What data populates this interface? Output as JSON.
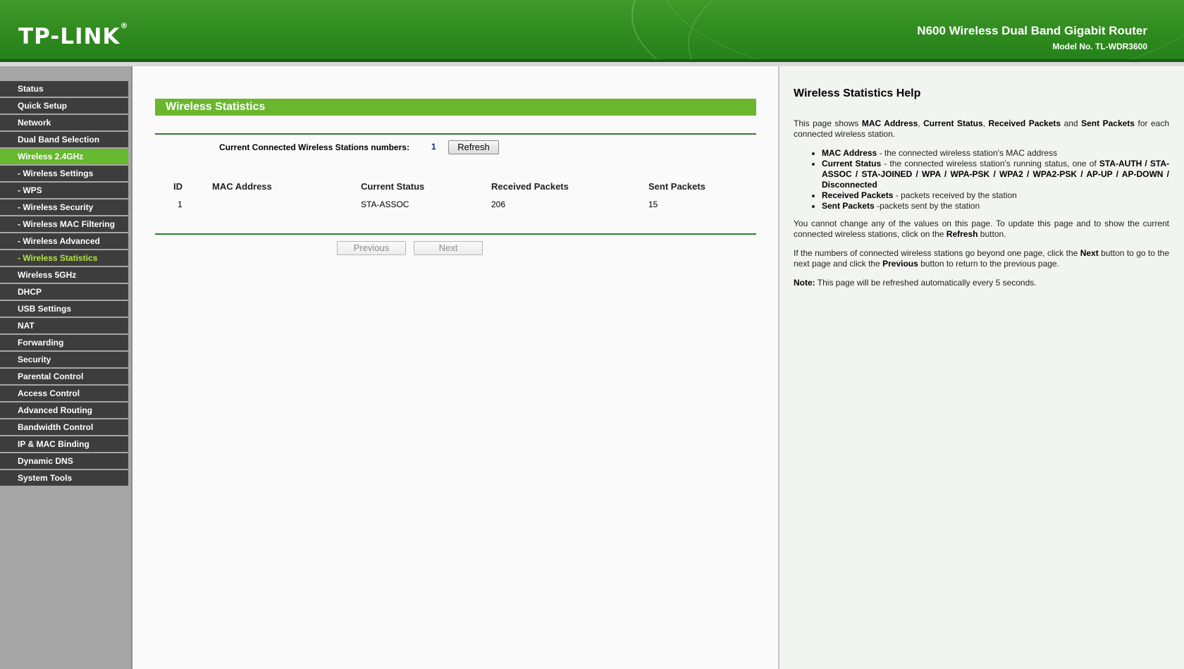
{
  "header": {
    "logo": "TP-LINK",
    "logo_mark": "®",
    "product": "N600 Wireless Dual Band Gigabit Router",
    "model": "Model No. TL-WDR3600"
  },
  "sidebar": {
    "items": [
      {
        "label": "Status"
      },
      {
        "label": "Quick Setup"
      },
      {
        "label": "Network"
      },
      {
        "label": "Dual Band Selection"
      },
      {
        "label": "Wireless 2.4GHz"
      },
      {
        "label": "- Wireless Settings"
      },
      {
        "label": "- WPS"
      },
      {
        "label": "- Wireless Security"
      },
      {
        "label": "- Wireless MAC Filtering"
      },
      {
        "label": "- Wireless Advanced"
      },
      {
        "label": "- Wireless Statistics"
      },
      {
        "label": "Wireless 5GHz"
      },
      {
        "label": "DHCP"
      },
      {
        "label": "USB Settings"
      },
      {
        "label": "NAT"
      },
      {
        "label": "Forwarding"
      },
      {
        "label": "Security"
      },
      {
        "label": "Parental Control"
      },
      {
        "label": "Access Control"
      },
      {
        "label": "Advanced Routing"
      },
      {
        "label": "Bandwidth Control"
      },
      {
        "label": "IP & MAC Binding"
      },
      {
        "label": "Dynamic DNS"
      },
      {
        "label": "System Tools"
      }
    ]
  },
  "main": {
    "title": "Wireless Statistics",
    "count_label": "Current Connected Wireless Stations numbers:",
    "count_value": "1",
    "refresh_label": "Refresh",
    "table": {
      "headers": [
        "ID",
        "MAC Address",
        "Current Status",
        "Received Packets",
        "Sent Packets"
      ],
      "rows": [
        {
          "id": "1",
          "mac": "",
          "status": "STA-ASSOC",
          "received": "206",
          "sent": "15"
        }
      ]
    },
    "previous_label": "Previous",
    "next_label": "Next"
  },
  "help": {
    "title": "Wireless Statistics Help",
    "intro": {
      "t1": "This page shows ",
      "b1": "MAC Address",
      "t2": ", ",
      "b2": "Current Status",
      "t3": ", ",
      "b3": "Received Packets",
      "t4": " and ",
      "b4": "Sent Packets",
      "t5": " for each connected wireless station."
    },
    "bullets": {
      "mac_term": "MAC Address",
      "mac_desc": " - the connected wireless station's MAC address",
      "status_term": "Current Status",
      "status_desc": " - the connected wireless station's running status, one of ",
      "status_values": "STA-AUTH / STA-ASSOC / STA-JOINED / WPA / WPA-PSK / WPA2 / WPA2-PSK / AP-UP / AP-DOWN / Disconnected",
      "recv_term": "Received Packets",
      "recv_desc": " - packets received by the station",
      "sent_term": "Sent Packets",
      "sent_desc": " -packets sent by the station"
    },
    "p2": {
      "t1": "You cannot change any of the values on this page. To update this page and to show the current connected wireless stations, click on the ",
      "b1": "Refresh",
      "t2": " button."
    },
    "p3": {
      "t1": "If the numbers of connected wireless stations go beyond one page, click the ",
      "b1": "Next",
      "t2": " button to go to the next page and click the ",
      "b2": "Previous",
      "t3": " button to return to the previous page."
    },
    "note": {
      "label": "Note:",
      "text": " This page will be refreshed automatically every 5 seconds."
    }
  },
  "colors": {
    "brand_green": "#6ab72e",
    "menu_bg": "#3d3d3d",
    "menu_active_bg": "#66b82e",
    "menu_current_text": "#b5ea3c"
  }
}
